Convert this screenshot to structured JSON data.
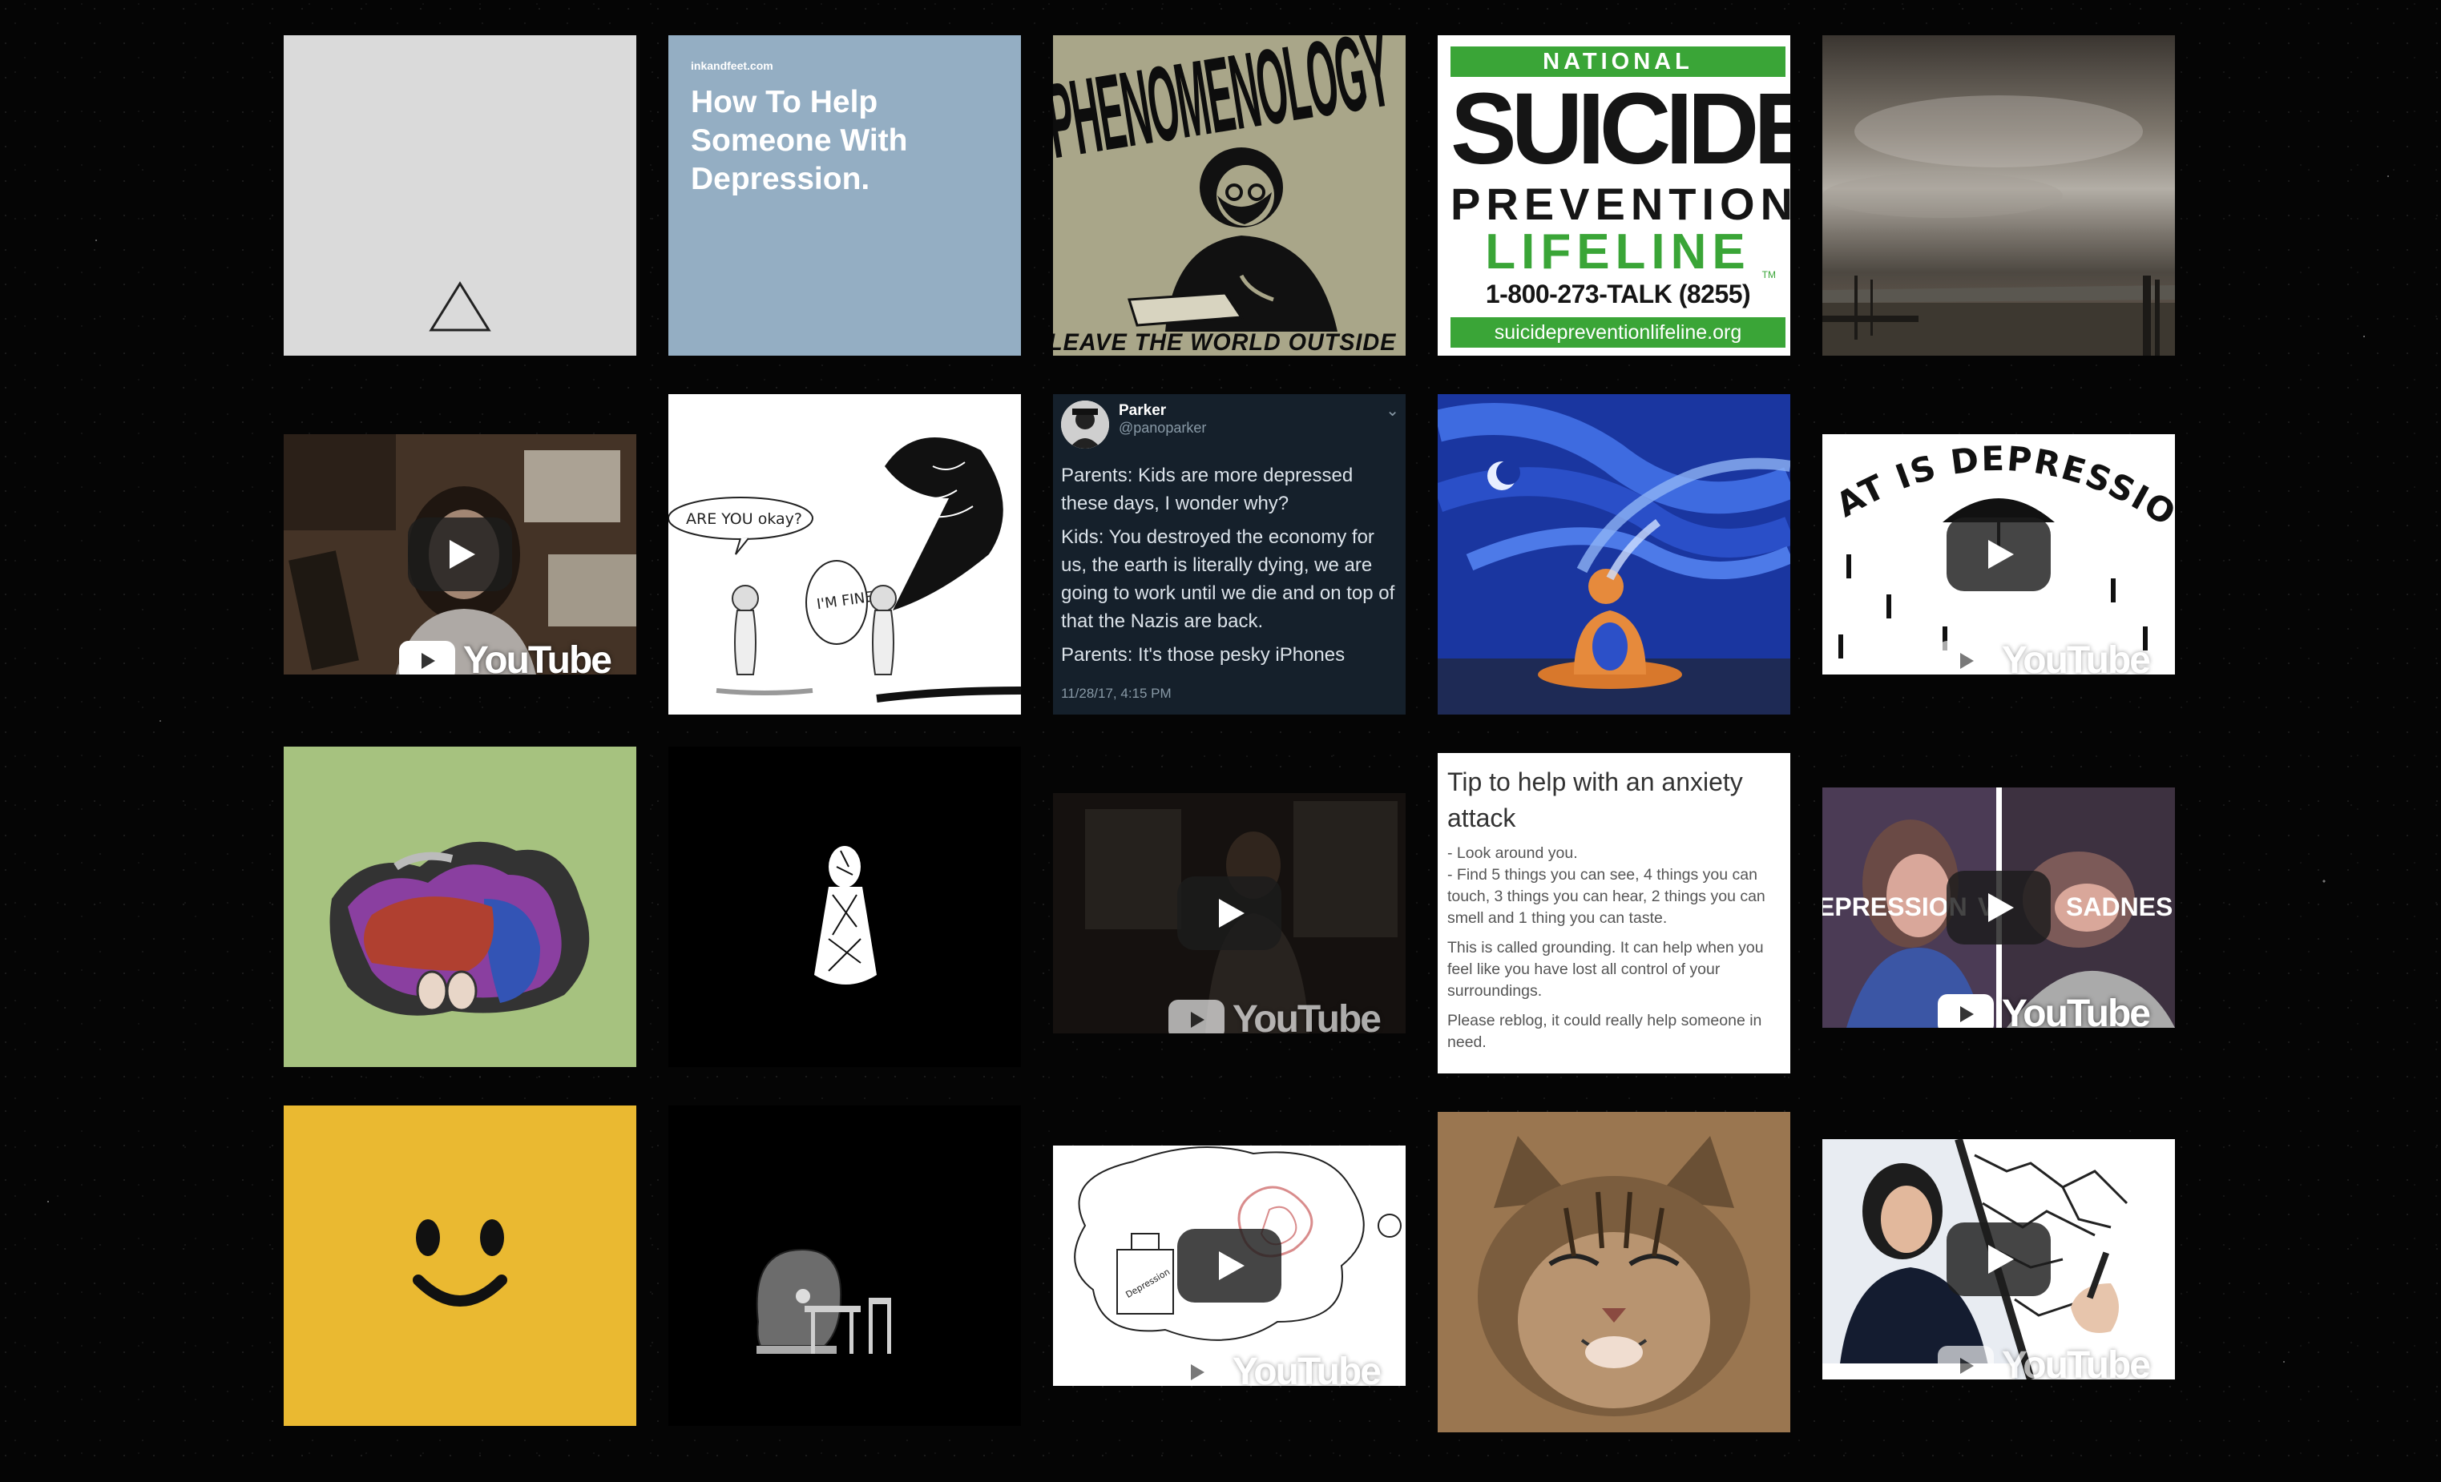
{
  "tiles": {
    "inkandfeet": {
      "site": "inkandfeet.com",
      "title": "How To Help Someone With Depression."
    },
    "phenomenology": {
      "title": "PHENOMENOLOGY",
      "caption": "LEAVE THE WORLD OUTSIDE"
    },
    "lifeline": {
      "national": "NATIONAL",
      "suicide": "SUICIDE",
      "prevention": "PREVENTION",
      "lifeline": "LIFELINE",
      "tm": "TM",
      "phone": "1-800-273-TALK (8255)",
      "url": "suicidepreventionlifeline.org"
    },
    "tweet": {
      "name": "Parker",
      "handle": "@panoparker",
      "line1": "Parents: Kids are more depressed these days, I wonder why?",
      "line2": "Kids: You destroyed the economy for us, the earth is literally dying, we are going to work until we die and on top of that the Nazis are back.",
      "line3": "Parents: It's those pesky iPhones",
      "timestamp": "11/28/17, 4:15 PM"
    },
    "comic": {
      "bubble1": "ARE YOU okay?",
      "bubble2": "I'M FINE"
    },
    "what_is_depression": {
      "title": "WHAT IS DEPRESSION?"
    },
    "tip": {
      "title": "Tip to help with an anxiety attack",
      "p1": "- Look around you.\n- Find 5 things you can see, 4 things you can touch, 3 things you can hear, 2 things you can smell and 1 thing you can taste.",
      "p2": "This is called grounding. It can help when you feel like you have lost all control of your surroundings.",
      "p3": "Please reblog, it could really help someone in need."
    },
    "depression_vs_sadness": {
      "left": "EPRESSION",
      "middle": "V",
      "right": "SADNES"
    },
    "thought_bubble": {
      "jar_label": "Depression"
    }
  },
  "youtube": {
    "label": "YouTube"
  },
  "colors": {
    "page_bg": "#050505",
    "ink_bg": "#94aec3",
    "pheno_bg": "#a9a689",
    "tweet_bg": "#15202b",
    "lifeline_green": "#3aa537",
    "smiley_bg": "#eab931",
    "green_bg": "#a6c27f"
  },
  "icons": {
    "play": "play-icon",
    "youtube": "youtube-logo-icon",
    "triangle": "triangle-icon"
  }
}
